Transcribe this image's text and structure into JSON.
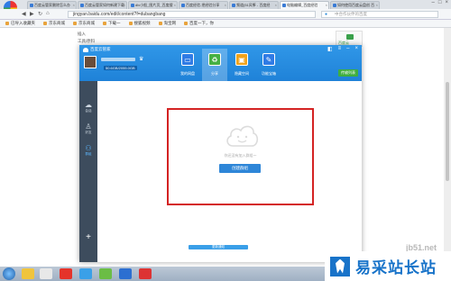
{
  "browser": {
    "tabs": [
      {
        "title": "百度云管家删除怎么办",
        "active": false
      },
      {
        "title": "百度云管家如何新建下载",
        "active": false
      },
      {
        "title": "dlv小船_图片页_百度搜",
        "active": false
      },
      {
        "title": "百度经验-把经验分享",
        "active": false
      },
      {
        "title": "频道(51风筝 - 百度经",
        "active": false
      },
      {
        "title": "电脑编辑_百度经验",
        "active": true
      },
      {
        "title": "如何使用百度云盘创 百",
        "active": false
      }
    ],
    "url": "jingyan.baidu.com/edit/content?f=dubangbang",
    "search_placeholder": "中合作伙伴的百度",
    "bookmarks": [
      "已导入收藏夹",
      "京东商城",
      "京东商城",
      "下载一",
      "搜狐视频",
      "淘宝网",
      "百度一下，你"
    ]
  },
  "page": {
    "side_items": [
      "插入",
      "工具/原料"
    ],
    "right_widget_label": "百度云"
  },
  "app": {
    "title": "百度云管家",
    "quota": "50.6GB/2055.0GB",
    "nav_tabs": [
      {
        "label": "我的网盘",
        "icon": "monitor-icon",
        "color": "#2f7be5"
      },
      {
        "label": "分享",
        "icon": "share-icon",
        "color": "#45b043",
        "active": true
      },
      {
        "label": "隐藏空间",
        "icon": "lock-icon",
        "color": "#f2a31b"
      },
      {
        "label": "功能宝箱",
        "icon": "tools-icon",
        "color": "#2f7be5"
      }
    ],
    "transfer_label": "传输列表",
    "sidebar": [
      {
        "label": "会话",
        "icon": "chat-icon"
      },
      {
        "label": "好友",
        "icon": "person-icon"
      },
      {
        "label": "群组",
        "icon": "group-icon",
        "active": true
      }
    ],
    "empty_text": "你还没有加入群组～",
    "create_button": "创建群组",
    "bottom_link": "更新通知"
  },
  "watermark": {
    "small": "jb51.net",
    "brand": "易采站长站"
  }
}
